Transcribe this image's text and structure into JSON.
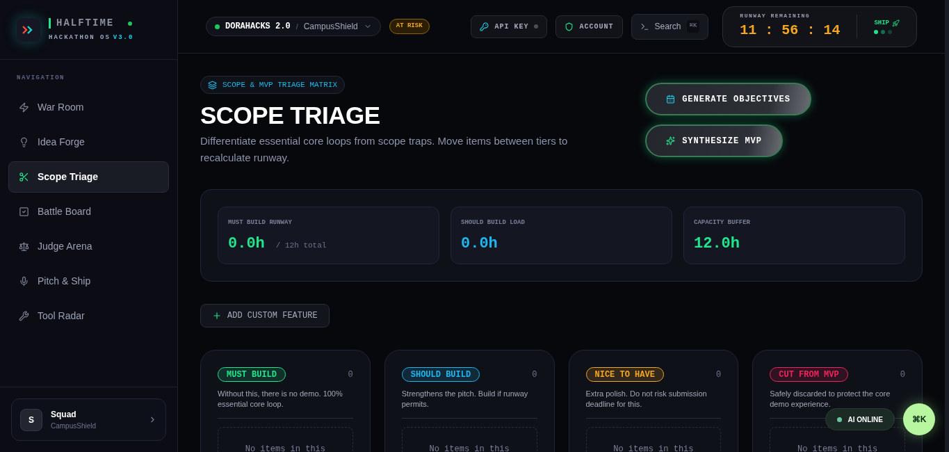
{
  "brand": {
    "name": "HALFTIME",
    "subtitle": "HACKATHON OS",
    "version": "V3.0"
  },
  "sidebar": {
    "heading": "NAVIGATION",
    "items": [
      {
        "label": "War Room",
        "selected": false
      },
      {
        "label": "Idea Forge",
        "selected": false
      },
      {
        "label": "Scope Triage",
        "selected": true
      },
      {
        "label": "Battle Board",
        "selected": false
      },
      {
        "label": "Judge Arena",
        "selected": false
      },
      {
        "label": "Pitch & Ship",
        "selected": false
      },
      {
        "label": "Tool Radar",
        "selected": false
      }
    ],
    "team": {
      "initial": "S",
      "name": "Squad",
      "project": "CampusShield"
    }
  },
  "topbar": {
    "event": "DORAHACKS 2.0",
    "separator": "/",
    "project": "CampusShield",
    "status": "AT RISK",
    "api_key": "API KEY",
    "account": "ACCOUNT",
    "search": "Search",
    "search_shortcut": "⌘K",
    "runway": {
      "label": "RUNWAY REMAINING",
      "time": "11 : 56 : 14",
      "ship": "SHIP"
    }
  },
  "page": {
    "tag": "SCOPE & MVP TRIAGE MATRIX",
    "title": "SCOPE TRIAGE",
    "description": "Differentiate essential core loops from scope traps. Move items between tiers to recalculate runway.",
    "actions": [
      "GENERATE OBJECTIVES",
      "SYNTHESIZE MVP"
    ]
  },
  "stats": [
    {
      "label": "MUST BUILD RUNWAY",
      "value": "0.0h",
      "note": "/ 12h total",
      "color": "#22e58b"
    },
    {
      "label": "SHOULD BUILD LOAD",
      "value": "0.0h",
      "color": "#1fb6f0"
    },
    {
      "label": "CAPACITY BUFFER",
      "value": "12.0h",
      "color": "#22e58b"
    }
  ],
  "add_button": "ADD CUSTOM FEATURE",
  "tiers": [
    {
      "label": "MUST BUILD",
      "count": "0",
      "description": "Without this, there is no demo. 100% essential core loop.",
      "color": "#22e58b",
      "empty": "No items in this"
    },
    {
      "label": "SHOULD BUILD",
      "count": "0",
      "description": "Strengthens the pitch. Build if runway permits.",
      "color": "#1fb6f0",
      "empty": "No items in this"
    },
    {
      "label": "NICE TO HAVE",
      "count": "0",
      "description": "Extra polish. Do not risk submission deadline for this.",
      "color": "#f5a623",
      "empty": "No items in this"
    },
    {
      "label": "CUT FROM MVP",
      "count": "0",
      "description": "Safely discarded to protect the core demo experience.",
      "color": "#f0245a",
      "empty": "No items in this"
    }
  ],
  "assistant": {
    "status": "AI ONLINE",
    "shortcut": "⌘K"
  }
}
